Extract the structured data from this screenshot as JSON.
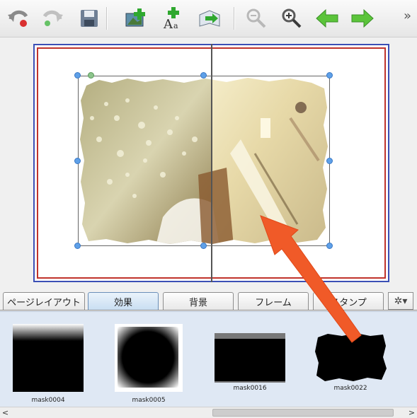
{
  "toolbar": {
    "buttons": [
      {
        "name": "undo-icon"
      },
      {
        "name": "redo-icon"
      },
      {
        "name": "save-icon"
      },
      {
        "name": "add-photo-icon"
      },
      {
        "name": "add-text-icon"
      },
      {
        "name": "export-icon"
      },
      {
        "name": "zoom-out-icon"
      },
      {
        "name": "zoom-in-icon"
      },
      {
        "name": "back-arrow-icon"
      },
      {
        "name": "forward-arrow-icon"
      }
    ],
    "more_label": "»"
  },
  "tabs": [
    {
      "label": "ページレイアウト",
      "active": false
    },
    {
      "label": "効果",
      "active": true
    },
    {
      "label": "背景",
      "active": false
    },
    {
      "label": "フレーム",
      "active": false
    },
    {
      "label": "スタンプ",
      "active": false
    }
  ],
  "tab_settings_icon": "gear-icon",
  "masks": [
    {
      "label": "mask0004"
    },
    {
      "label": "mask0005"
    },
    {
      "label": "mask0016"
    },
    {
      "label": "mask0022"
    }
  ],
  "scrollbar": {
    "left_arrow": "<",
    "right_arrow": ">"
  },
  "colors": {
    "page_border_outer": "#3b4fb5",
    "page_border_inner": "#c0332b",
    "annotation_arrow": "#f05a28",
    "active_tab": "#c9def2",
    "panel_bg": "#dfe8f4"
  }
}
